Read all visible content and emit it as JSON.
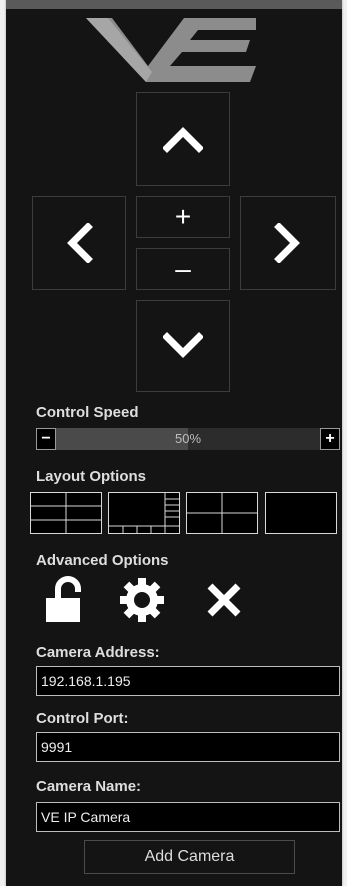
{
  "ptz": {
    "up_icon": "chevron-up-icon",
    "down_icon": "chevron-down-icon",
    "left_icon": "chevron-left-icon",
    "right_icon": "chevron-right-icon",
    "zoom_in_label": "+",
    "zoom_out_label": "–"
  },
  "control_speed": {
    "label": "Control Speed",
    "value_text": "50%",
    "value": 0.5,
    "minus_label": "−",
    "plus_label": "+"
  },
  "layout_options": {
    "label": "Layout Options",
    "items": [
      "layout-grid-3x2",
      "layout-1-plus-6",
      "layout-grid-2x2",
      "layout-single"
    ]
  },
  "advanced_options": {
    "label": "Advanced Options",
    "icons": [
      "unlock-icon",
      "gear-icon",
      "close-icon"
    ]
  },
  "camera_address": {
    "label": "Camera Address:",
    "value": "192.168.1.195"
  },
  "control_port": {
    "label": "Control Port:",
    "value": "9991"
  },
  "camera_name": {
    "label": "Camera Name:",
    "value": "VE IP Camera"
  },
  "add_camera_label": "Add Camera",
  "colors": {
    "panel_bg": "#141414",
    "logo_gray": "#8c8c8c",
    "text": "#dedede",
    "border": "#3c3c3c"
  }
}
